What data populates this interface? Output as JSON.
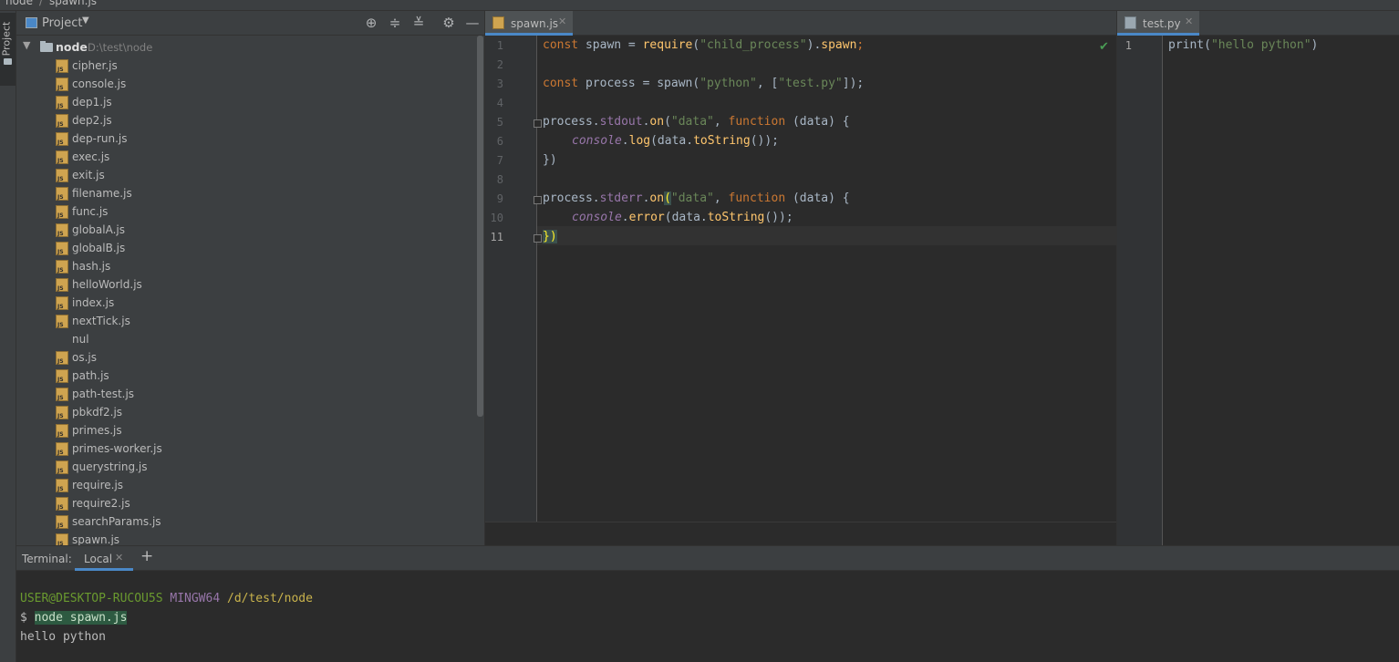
{
  "breadcrumb": {
    "items": [
      "node",
      "spawn.js"
    ]
  },
  "toolstrip": {
    "project_tab": "Project"
  },
  "project": {
    "title": "Project",
    "root": {
      "name": "node",
      "path": "D:\\test\\node"
    },
    "files": [
      "cipher.js",
      "console.js",
      "dep1.js",
      "dep2.js",
      "dep-run.js",
      "exec.js",
      "exit.js",
      "filename.js",
      "func.js",
      "globalA.js",
      "globalB.js",
      "hash.js",
      "helloWorld.js",
      "index.js",
      "nextTick.js",
      "nul",
      "os.js",
      "path.js",
      "path-test.js",
      "pbkdf2.js",
      "primes.js",
      "primes-worker.js",
      "querystring.js",
      "require.js",
      "require2.js",
      "searchParams.js",
      "spawn.js"
    ]
  },
  "editor1": {
    "tab": "spawn.js",
    "line_numbers": [
      "1",
      "2",
      "3",
      "4",
      "5",
      "6",
      "7",
      "8",
      "9",
      "10",
      "11"
    ],
    "code": {
      "l1": {
        "kw": "const",
        "a": " spawn = ",
        "fn": "require",
        "b": "(",
        "str": "\"child_process\"",
        "c": ").",
        "fld": "spawn",
        "d": ";"
      },
      "l3": {
        "kw": "const",
        "a": " process = spawn(",
        "s1": "\"python\"",
        "b": ", [",
        "s2": "\"test.py\"",
        "c": "]);"
      },
      "l5": {
        "a": "process.",
        "fld": "stdout",
        "b": ".",
        "fn": "on",
        "c": "(",
        "str": "\"data\"",
        "d": ", ",
        "kw": "function",
        "e": " (data) {"
      },
      "l6": {
        "glob": "console",
        "a": ".",
        "fn": "log",
        "b": "(data.",
        "fn2": "toString",
        "c": "());"
      },
      "l7": {
        "a": "})"
      },
      "l9": {
        "a": "process.",
        "fld": "stderr",
        "b": ".",
        "fn": "on",
        "brk": "(",
        "str": "\"data\"",
        "d": ", ",
        "kw": "function",
        "e": " (data) {"
      },
      "l10": {
        "glob": "console",
        "a": ".",
        "fn": "error",
        "b": "(data.",
        "fn2": "toString",
        "c": "());"
      },
      "l11": {
        "a": "}",
        "brk": ")"
      }
    }
  },
  "editor2": {
    "tab": "test.py",
    "line_numbers": [
      "1"
    ],
    "code": {
      "fn": "print",
      "a": "(",
      "str": "\"hello python\"",
      "b": ")"
    }
  },
  "terminal": {
    "label": "Terminal:",
    "tab": "Local",
    "prompt": {
      "user": "USER@DESKTOP-RUCOU5S",
      "shell": "MINGW64",
      "path": "/d/test/node"
    },
    "dollar": "$ ",
    "command": "node spawn.js",
    "output": "hello python"
  },
  "colors": {
    "accent": "#4a88c7",
    "keyword": "#cc7832",
    "string": "#6a8759",
    "field": "#9876aa",
    "function": "#ffc66d"
  }
}
